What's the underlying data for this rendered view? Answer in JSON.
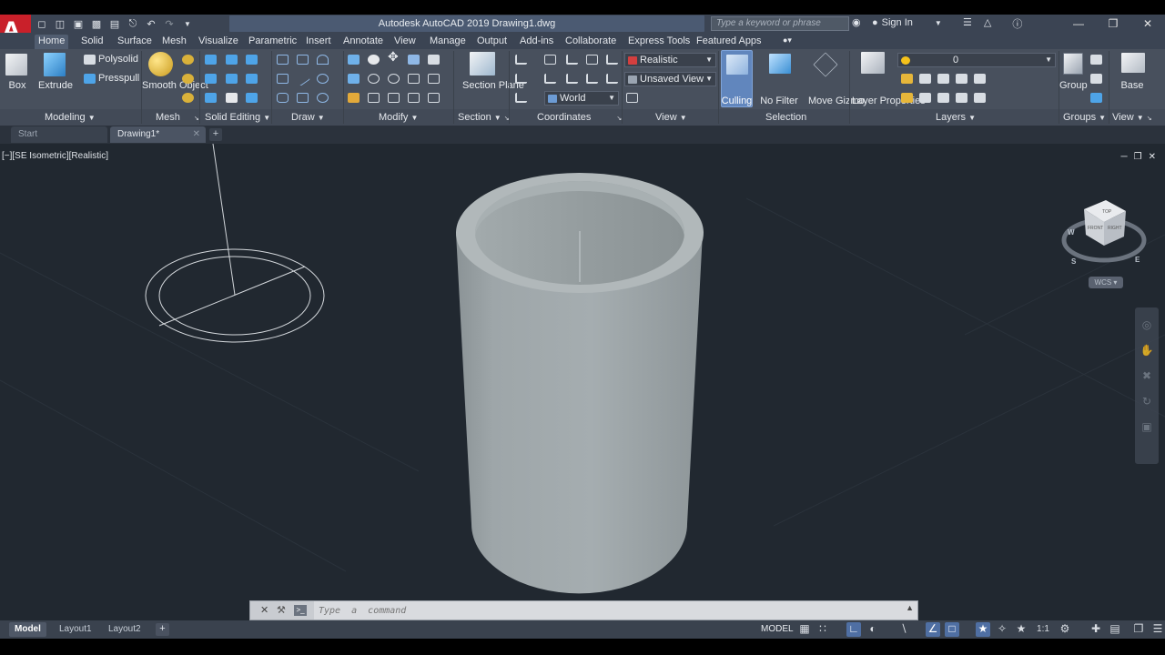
{
  "window": {
    "app_logo": "A",
    "title": "Autodesk AutoCAD 2019    Drawing1.dwg",
    "search_placeholder": "Type a keyword or phrase",
    "sign_in": "Sign In"
  },
  "ribbon": {
    "tabs": [
      "Home",
      "Solid",
      "Surface",
      "Mesh",
      "Visualize",
      "Parametric",
      "Insert",
      "Annotate",
      "View",
      "Manage",
      "Output",
      "Add-ins",
      "Collaborate",
      "Express Tools",
      "Featured Apps"
    ],
    "active_tab": "Home",
    "panels": {
      "modeling": {
        "title": "Modeling",
        "box": "Box",
        "extrude": "Extrude",
        "polysolid": "Polysolid",
        "presspull": "Presspull"
      },
      "mesh": {
        "title": "Mesh",
        "smooth_object": "Smooth Object"
      },
      "solid_editing": {
        "title": "Solid Editing"
      },
      "draw": {
        "title": "Draw"
      },
      "modify": {
        "title": "Modify"
      },
      "section": {
        "title": "Section",
        "section_plane": "Section Plane"
      },
      "coordinates": {
        "title": "Coordinates",
        "ucs_value": "World"
      },
      "view": {
        "title": "View",
        "visual_style": "Realistic",
        "named_view": "Unsaved View"
      },
      "selection": {
        "title": "Selection",
        "culling": "Culling",
        "no_filter": "No Filter",
        "move_gizmo": "Move Gizmo"
      },
      "layers": {
        "title": "Layers",
        "layer_properties": "Layer Properties",
        "current_layer": "0"
      },
      "groups": {
        "title": "Groups",
        "group": "Group"
      },
      "view2": {
        "title": "View",
        "base": "Base"
      }
    }
  },
  "file_tabs": [
    {
      "label": "Start",
      "active": false
    },
    {
      "label": "Drawing1*",
      "active": true
    }
  ],
  "viewport": {
    "label": "[−][SE Isometric][Realistic]",
    "wcs": "WCS",
    "viewcube": {
      "top": "TOP",
      "front": "FRONT",
      "right": "RIGHT",
      "compass": {
        "w": "W",
        "s": "S",
        "e": "E"
      }
    }
  },
  "command_line": {
    "placeholder": "Type  a  command"
  },
  "status": {
    "layouts": [
      {
        "label": "Model",
        "active": true
      },
      {
        "label": "Layout1",
        "active": false
      },
      {
        "label": "Layout2",
        "active": false
      }
    ],
    "model": "MODEL",
    "scale": "1:1"
  },
  "colors": {
    "accent_blue": "#4f6fa3",
    "logo_red": "#c9202a",
    "viewport_bg": "#212830",
    "ribbon_bg": "#48505d"
  }
}
